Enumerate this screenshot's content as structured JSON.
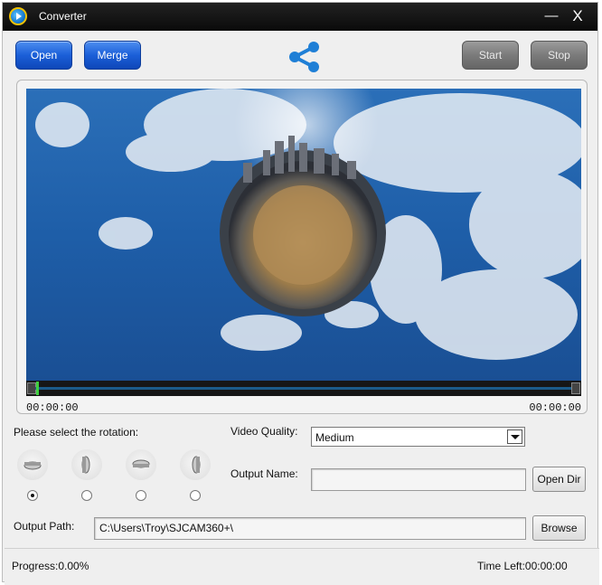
{
  "window": {
    "title": "Converter",
    "minimize_glyph": "—",
    "close_glyph": "X"
  },
  "toolbar": {
    "open_label": "Open",
    "merge_label": "Merge",
    "share_icon": "share-icon",
    "start_label": "Start",
    "stop_label": "Stop"
  },
  "player": {
    "time_current": "00:00:00",
    "time_total": "00:00:00",
    "seek_progress": 0
  },
  "rotation": {
    "label": "Please select the rotation:",
    "options": [
      {
        "icon": "rotation-top-icon",
        "selected": true
      },
      {
        "icon": "rotation-left-icon",
        "selected": false
      },
      {
        "icon": "rotation-bottom-icon",
        "selected": false
      },
      {
        "icon": "rotation-right-icon",
        "selected": false
      }
    ]
  },
  "quality": {
    "label": "Video Quality:",
    "value": "Medium"
  },
  "output_name": {
    "label": "Output Name:",
    "value": "",
    "open_dir_label": "Open Dir"
  },
  "output_path": {
    "label": "Output Path:",
    "value": "C:\\Users\\Troy\\SJCAM360+\\",
    "browse_label": "Browse"
  },
  "status": {
    "progress": "Progress:0.00%",
    "time_left": "Time Left:00:00:00"
  },
  "colors": {
    "accent_blue": "#1b5fd8",
    "disabled_grey": "#7b7b7b",
    "share_blue": "#1f7fd6"
  }
}
